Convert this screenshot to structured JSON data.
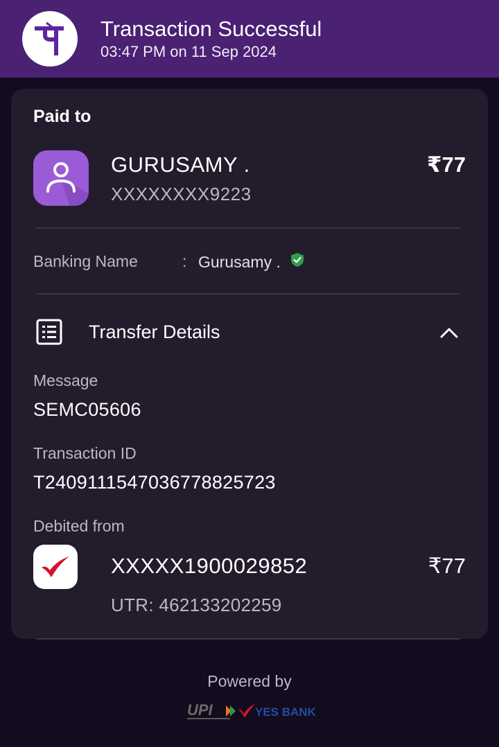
{
  "header": {
    "title": "Transaction Successful",
    "timestamp": "03:47 PM on 11 Sep 2024",
    "brand_glyph": "पे",
    "brand_color": "#4a2173"
  },
  "payee": {
    "section_label": "Paid to",
    "name": "GURUSAMY .",
    "account": "XXXXXXXX9223",
    "amount": "₹77",
    "avatar_icon": "person-icon"
  },
  "banking_name": {
    "label": "Banking Name",
    "separator": ":",
    "value": "Gurusamy .",
    "verified_icon": "verified-shield-icon",
    "verified_color": "#2e9e4b"
  },
  "transfer_details": {
    "title": "Transfer Details",
    "expanded": true,
    "message_label": "Message",
    "message_value": "SEMC05606",
    "txn_label": "Transaction ID",
    "txn_value": "T2409111547036778825723",
    "debited_label": "Debited from",
    "debited_account": "XXXXX1900029852",
    "debited_amount": "₹77",
    "utr": "UTR: 462133202259"
  },
  "footer": {
    "powered_by": "Powered by",
    "upi_text": "UPI",
    "bank_text": "YES BANK"
  }
}
